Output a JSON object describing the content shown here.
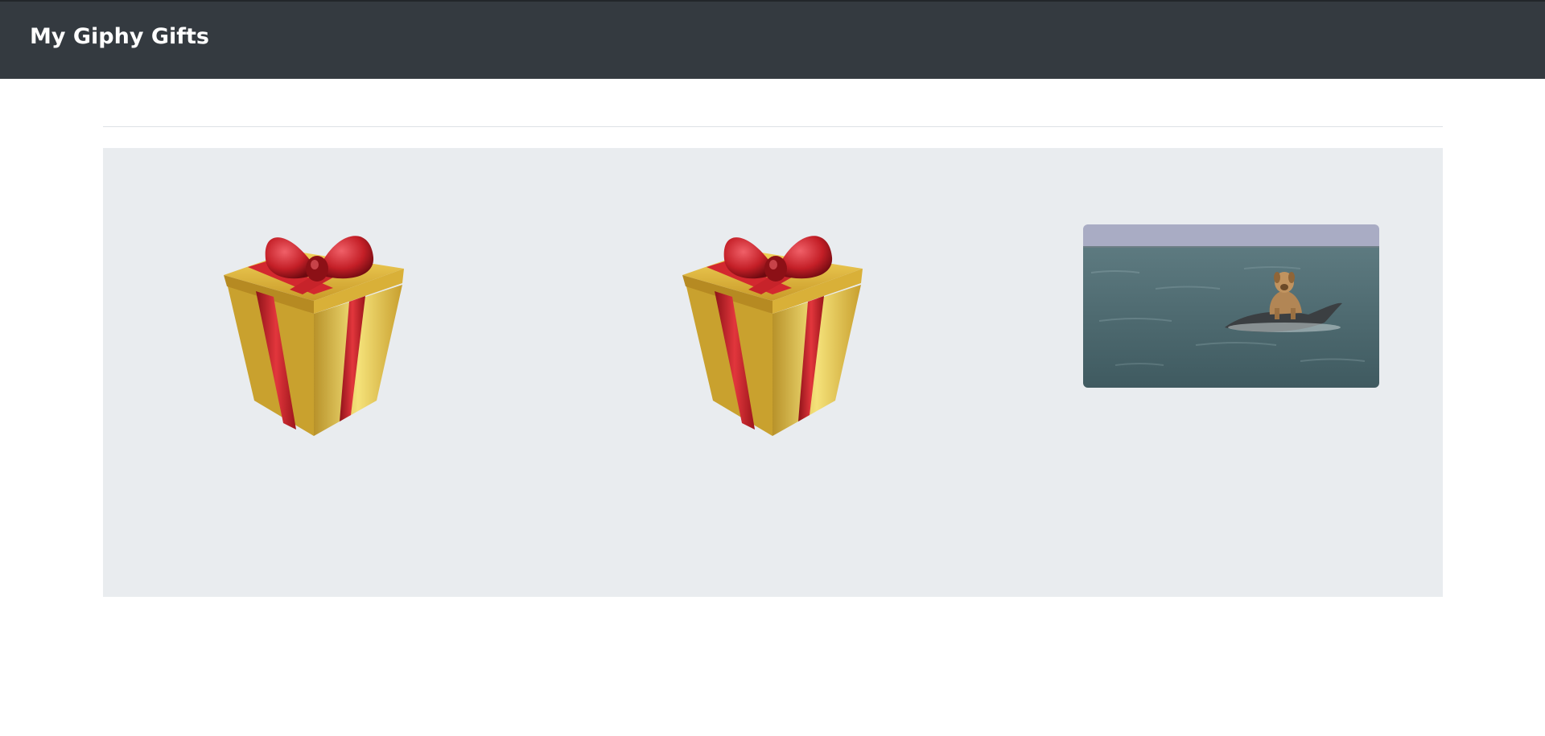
{
  "navbar": {
    "brand": "My Giphy Gifts",
    "background": "#343a40"
  },
  "gallery": {
    "background": "#e9ecef",
    "items": [
      {
        "kind": "wrapped-gift",
        "icon": "gift-icon"
      },
      {
        "kind": "wrapped-gift",
        "icon": "gift-icon"
      },
      {
        "kind": "opened-gif",
        "image": "dog-riding-dolphin-gif"
      }
    ]
  }
}
